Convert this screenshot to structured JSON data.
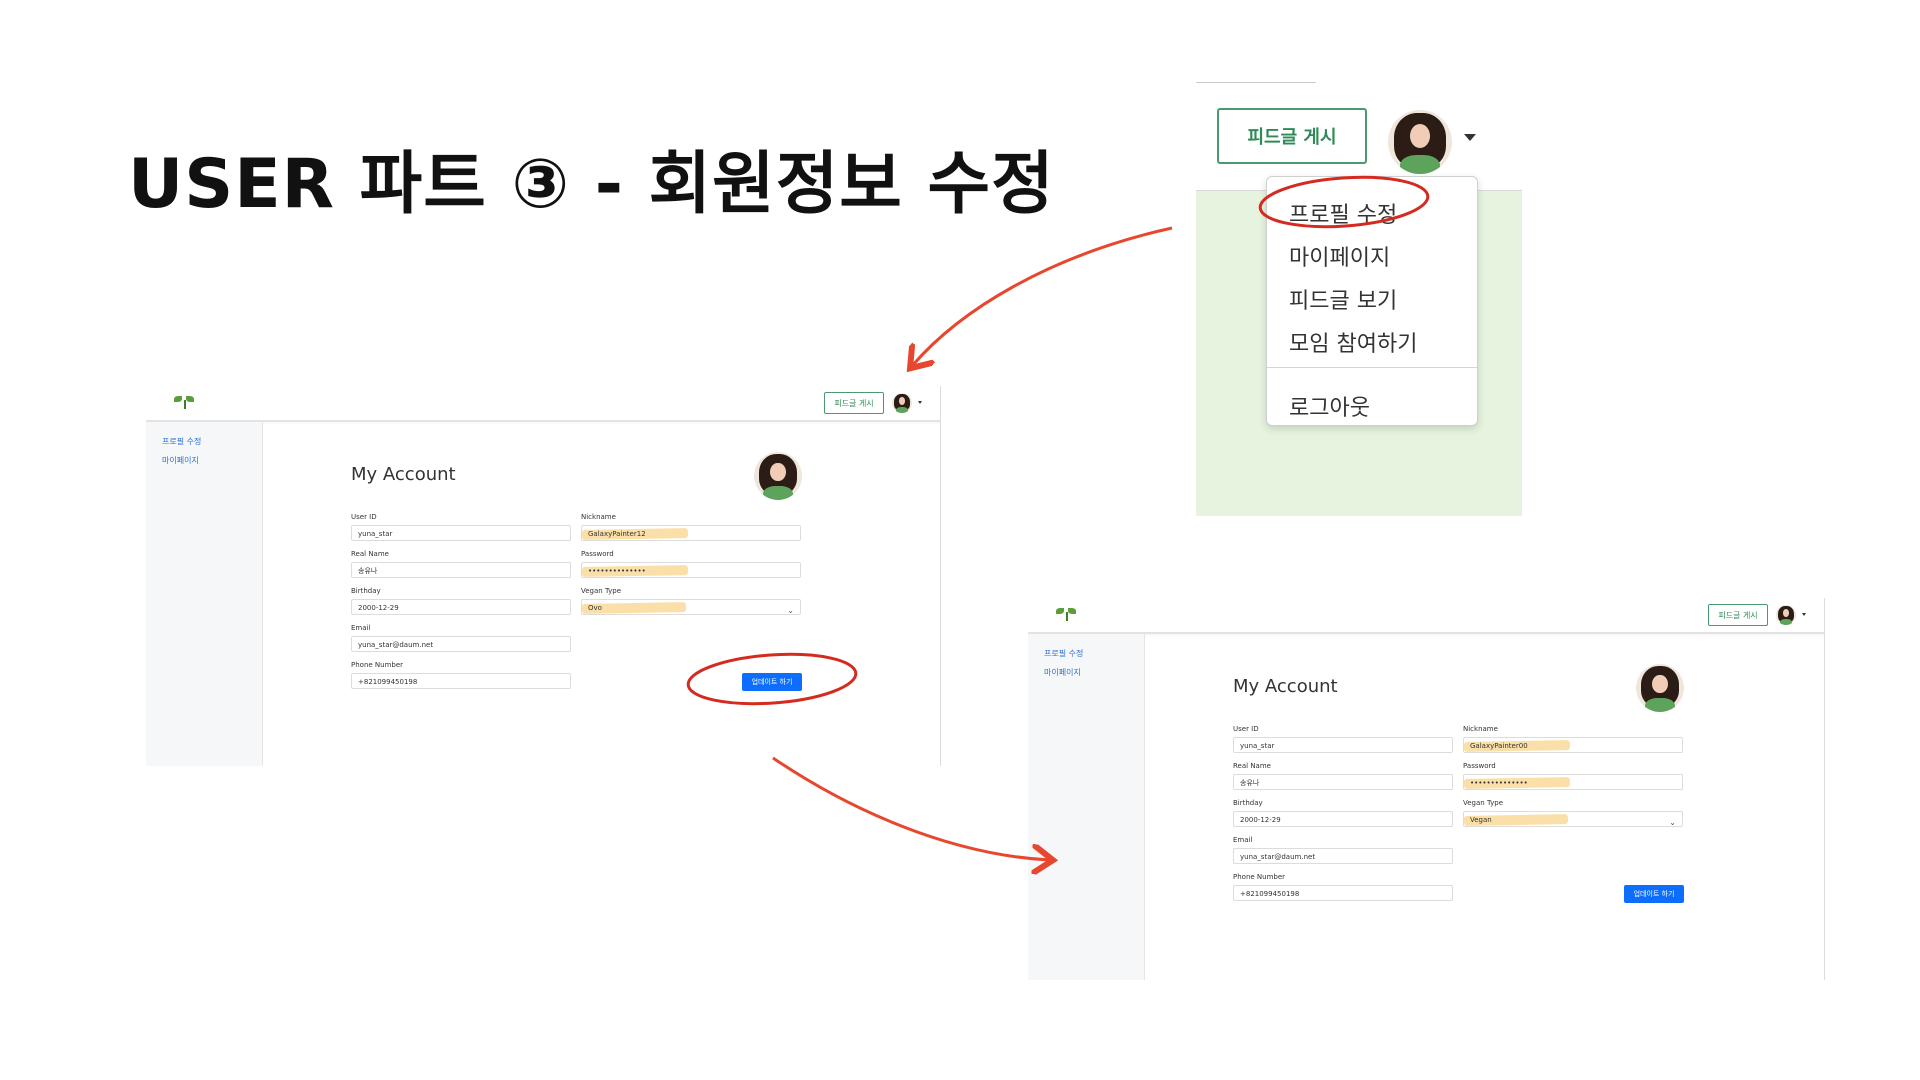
{
  "slide": {
    "title": "USER 파트 ③ - 회원정보 수정"
  },
  "zoom": {
    "post_button": "피드글 게시",
    "menu": [
      "프로필 수정",
      "마이페이지",
      "피드글 보기",
      "모임 참여하기",
      "로그아웃"
    ]
  },
  "before": {
    "nav": {
      "post_button": "피드글 게시"
    },
    "sidebar": [
      "프로필 수정",
      "마이페이지"
    ],
    "heading": "My Account",
    "labels": {
      "user_id": "User ID",
      "nickname": "Nickname",
      "real_name": "Real Name",
      "password": "Password",
      "birthday": "Birthday",
      "vegan_type": "Vegan Type",
      "email": "Email",
      "phone": "Phone Number"
    },
    "values": {
      "user_id": "yuna_star",
      "nickname": "GalaxyPainter12",
      "real_name": "송유나",
      "password": "••••••••••••••",
      "birthday": "2000-12-29",
      "vegan_type": "Ovo",
      "email": "yuna_star@daum.net",
      "phone": "+821099450198"
    },
    "update_button": "업데이트 하기"
  },
  "after": {
    "nav": {
      "post_button": "피드글 게시"
    },
    "sidebar": [
      "프로필 수정",
      "마이페이지"
    ],
    "heading": "My Account",
    "labels": {
      "user_id": "User ID",
      "nickname": "Nickname",
      "real_name": "Real Name",
      "password": "Password",
      "birthday": "Birthday",
      "vegan_type": "Vegan Type",
      "email": "Email",
      "phone": "Phone Number"
    },
    "values": {
      "user_id": "yuna_star",
      "nickname": "GalaxyPainter00",
      "real_name": "송유나",
      "password": "••••••••••••••",
      "birthday": "2000-12-29",
      "vegan_type": "Vegan",
      "email": "yuna_star@daum.net",
      "phone": "+821099450198"
    },
    "update_button": "업데이트 하기"
  },
  "colors": {
    "accent_green": "#4a9a6f",
    "primary_blue": "#0d6efd",
    "annotation_red": "#e8472f",
    "highlight": "#f7c460"
  },
  "icons": [
    "logo-sprout-icon",
    "avatar-photo",
    "caret-down-icon",
    "chevron-down-icon",
    "arrow-icon"
  ]
}
